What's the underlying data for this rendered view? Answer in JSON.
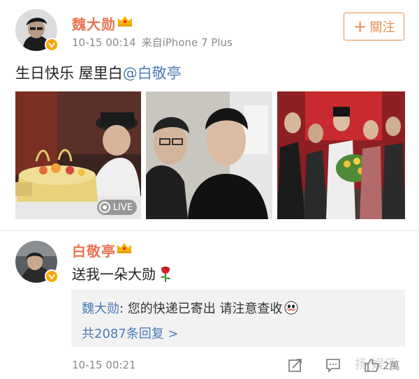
{
  "post": {
    "author": "魏大勋",
    "time": "10-15 00:14",
    "source": "来自iPhone 7 Plus",
    "follow_label": "關注",
    "follow_plus": "+",
    "text_prefix": "生日快乐 屋里白",
    "mention": "@白敬亭",
    "live_label": "LIVE"
  },
  "reply": {
    "author": "白敬亭",
    "text": "送我一朵大勋",
    "quote_author": "魏大勋",
    "quote_text": ": 您的快递已寄出 请注意查收",
    "more_replies": "共2087条回复 >",
    "time": "10-15 00:21",
    "like_count": "2萬"
  },
  "colors": {
    "name": "#eb7350",
    "link": "#4a7bb6",
    "follow_border": "#e38f4f",
    "quote_bg": "#f2f2f2"
  },
  "icons": [
    "crown-icon",
    "verified-badge-icon",
    "live-icon",
    "repost-icon",
    "comment-icon",
    "like-icon",
    "rose-icon",
    "emoji-icon"
  ]
}
